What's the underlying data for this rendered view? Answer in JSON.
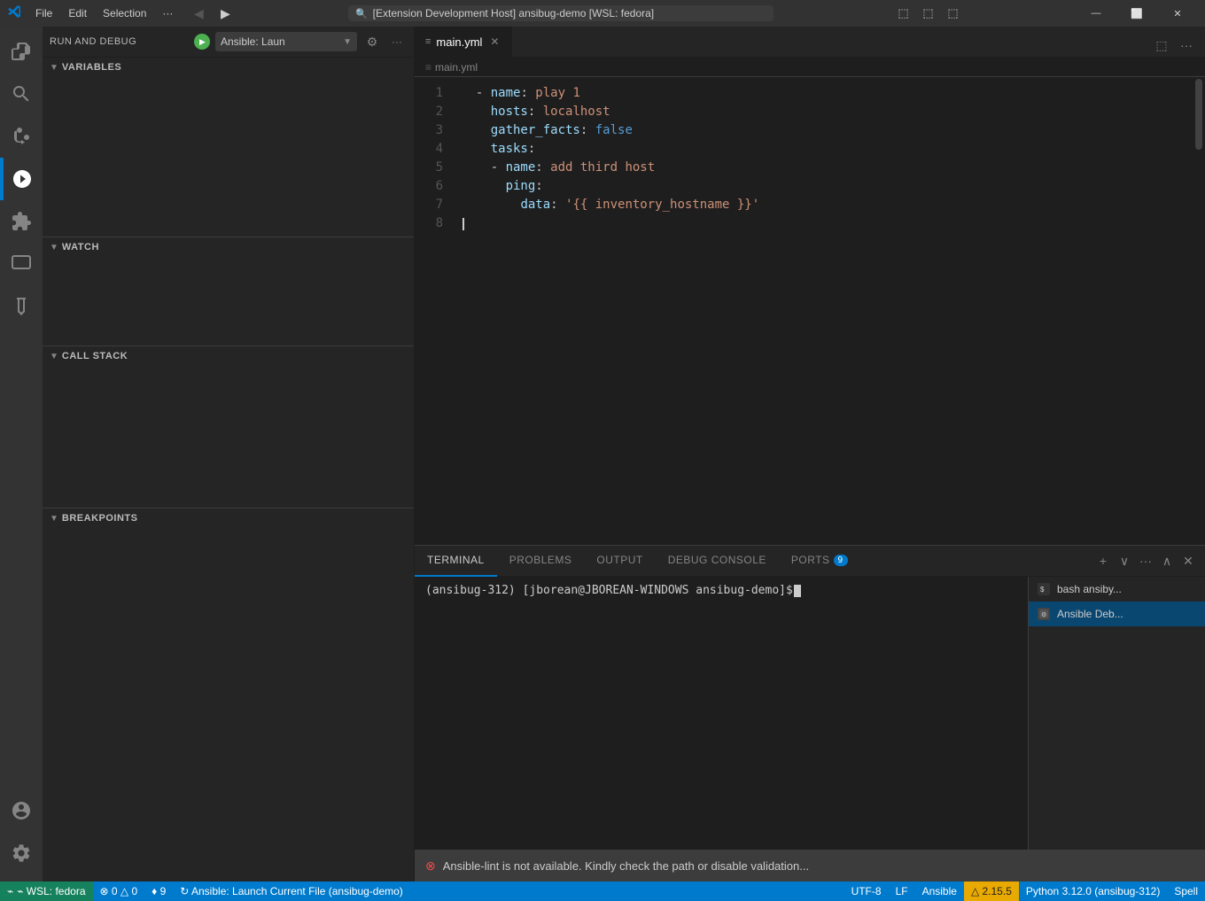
{
  "titlebar": {
    "logo": "VS",
    "menu": [
      "File",
      "Edit",
      "Selection",
      "···"
    ],
    "nav_back": "◀",
    "nav_forward": "▶",
    "search_text": "[Extension Development Host] ansibug-demo [WSL: fedora]",
    "icons": [
      "⬜",
      "⬜",
      "⬜⬜"
    ],
    "window_controls": [
      "—",
      "⬜",
      "✕"
    ]
  },
  "activity_bar": {
    "items": [
      {
        "name": "explorer",
        "icon": "⬜",
        "active": false
      },
      {
        "name": "search",
        "icon": "🔍",
        "active": false
      },
      {
        "name": "source-control",
        "icon": "⑂",
        "active": false
      },
      {
        "name": "run-debug",
        "icon": "▷",
        "active": true
      },
      {
        "name": "extensions",
        "icon": "⊞",
        "active": false
      },
      {
        "name": "remote-explorer",
        "icon": "⊙",
        "active": false
      },
      {
        "name": "test",
        "icon": "⚗",
        "active": false
      }
    ],
    "bottom_items": [
      {
        "name": "accounts",
        "icon": "👤"
      },
      {
        "name": "settings",
        "icon": "⚙"
      }
    ]
  },
  "sidebar": {
    "debug_bar": {
      "title": "RUN AND DEBUG",
      "launch_config": "Ansible: Laun",
      "gear_tooltip": "Open launch.json",
      "more_tooltip": "More"
    },
    "variables": {
      "title": "VARIABLES",
      "collapsed": false
    },
    "watch": {
      "title": "WATCH",
      "collapsed": false
    },
    "call_stack": {
      "title": "CALL STACK",
      "collapsed": false
    },
    "breakpoints": {
      "title": "BREAKPOINTS",
      "collapsed": false
    }
  },
  "editor": {
    "tab": {
      "filename": "main.yml",
      "icon": "≡"
    },
    "breadcrumb": {
      "filename": "main.yml"
    },
    "lines": [
      {
        "num": 1,
        "content": [
          {
            "text": "  - ",
            "cls": "c-dash"
          },
          {
            "text": "name",
            "cls": "c-key"
          },
          {
            "text": ": ",
            "cls": "c-colon"
          },
          {
            "text": "play 1",
            "cls": "c-str"
          }
        ]
      },
      {
        "num": 2,
        "content": [
          {
            "text": "    ",
            "cls": ""
          },
          {
            "text": "hosts",
            "cls": "c-key"
          },
          {
            "text": ": ",
            "cls": "c-colon"
          },
          {
            "text": "localhost",
            "cls": "c-str"
          }
        ]
      },
      {
        "num": 3,
        "content": [
          {
            "text": "    ",
            "cls": ""
          },
          {
            "text": "gather_facts",
            "cls": "c-key"
          },
          {
            "text": ": ",
            "cls": "c-colon"
          },
          {
            "text": "false",
            "cls": "c-bool"
          }
        ]
      },
      {
        "num": 4,
        "content": [
          {
            "text": "    ",
            "cls": ""
          },
          {
            "text": "tasks",
            "cls": "c-key"
          },
          {
            "text": ":",
            "cls": "c-colon"
          }
        ]
      },
      {
        "num": 5,
        "content": [
          {
            "text": "    - ",
            "cls": "c-dash"
          },
          {
            "text": "name",
            "cls": "c-key"
          },
          {
            "text": ": ",
            "cls": "c-colon"
          },
          {
            "text": "add third host",
            "cls": "c-str"
          }
        ]
      },
      {
        "num": 6,
        "content": [
          {
            "text": "      ",
            "cls": ""
          },
          {
            "text": "ping",
            "cls": "c-key"
          },
          {
            "text": ":",
            "cls": "c-colon"
          }
        ]
      },
      {
        "num": 7,
        "content": [
          {
            "text": "        ",
            "cls": ""
          },
          {
            "text": "data",
            "cls": "c-key"
          },
          {
            "text": ": ",
            "cls": "c-colon"
          },
          {
            "text": "'{{ inventory_hostname }}'",
            "cls": "c-template"
          }
        ]
      },
      {
        "num": 8,
        "content": [
          {
            "text": "",
            "cls": ""
          }
        ]
      }
    ]
  },
  "bottom_panel": {
    "tabs": [
      {
        "label": "TERMINAL",
        "active": true
      },
      {
        "label": "PROBLEMS",
        "active": false
      },
      {
        "label": "OUTPUT",
        "active": false
      },
      {
        "label": "DEBUG CONSOLE",
        "active": false
      },
      {
        "label": "PORTS",
        "active": false,
        "badge": "9"
      }
    ],
    "terminal": {
      "prompt": "(ansibug-312) [jborean@JBOREAN-WINDOWS ansibug-demo]$ "
    },
    "side_items": [
      {
        "label": "bash  ansibу...",
        "type": "bash"
      },
      {
        "label": "Ansible Deb...",
        "type": "ansible",
        "active": true
      }
    ]
  },
  "notification": {
    "text": "Ansible-lint is not available. Kindly check the path or disable validation..."
  },
  "status_bar": {
    "left": [
      {
        "text": "⌁ WSL: fedora",
        "type": "remote"
      },
      {
        "text": "⊗ 0  △ 0",
        "type": "normal"
      },
      {
        "text": "♦ 9",
        "type": "normal"
      },
      {
        "text": "↻ Ansible: Launch Current File (ansibug-demo)",
        "type": "normal"
      }
    ],
    "right": [
      {
        "text": "UTF-8"
      },
      {
        "text": "LF"
      },
      {
        "text": "Ansible"
      },
      {
        "text": "△ 2.15.5",
        "type": "warning"
      },
      {
        "text": "Python 3.12.0 (ansibug-312)"
      },
      {
        "text": "Spell"
      }
    ]
  }
}
